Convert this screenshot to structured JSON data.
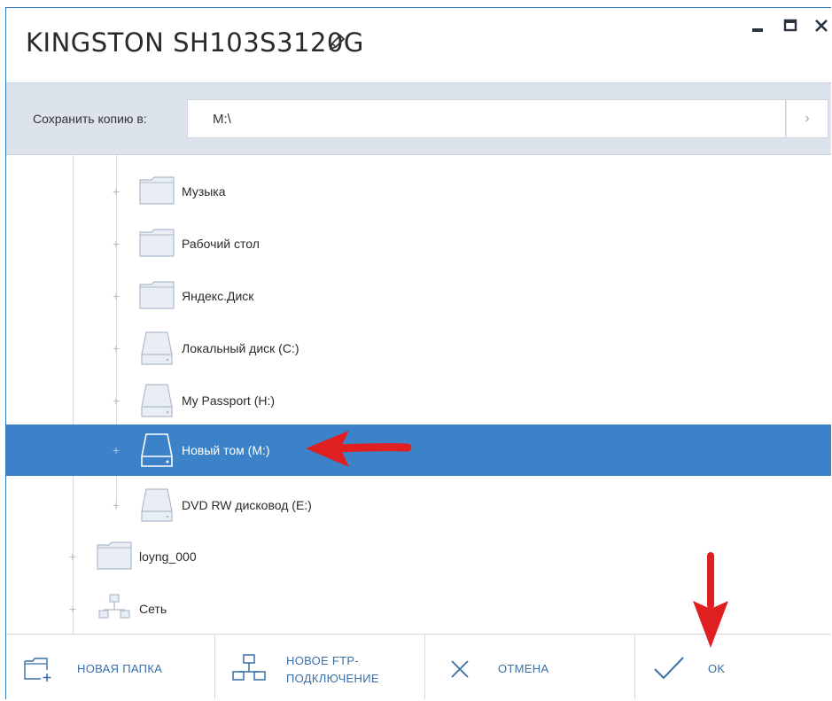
{
  "window": {
    "title": "KINGSTON SH103S3120G"
  },
  "pathbar": {
    "label": "Сохранить копию в:",
    "value": "M:\\",
    "go_glyph": "›"
  },
  "tree": {
    "items": [
      {
        "label": "Музыка",
        "icon": "folder-icon",
        "selected": false
      },
      {
        "label": "Рабочий стол",
        "icon": "folder-icon",
        "selected": false
      },
      {
        "label": "Яндекс.Диск",
        "icon": "folder-icon",
        "selected": false
      },
      {
        "label": "Локальный диск (C:)",
        "icon": "drive-icon",
        "selected": false
      },
      {
        "label": "My Passport (H:)",
        "icon": "drive-icon",
        "selected": false
      },
      {
        "label": "Новый том (M:)",
        "icon": "drive-icon",
        "selected": true
      },
      {
        "label": "DVD RW дисковод (E:)",
        "icon": "drive-icon",
        "selected": false
      },
      {
        "label": "loyng_000",
        "icon": "folder-icon",
        "selected": false
      },
      {
        "label": "Сеть",
        "icon": "network-icon",
        "selected": false
      }
    ]
  },
  "bottombar": {
    "new_folder": "НОВАЯ ПАПКА",
    "new_ftp_line1": "НОВОЕ FTP-",
    "new_ftp_line2": "ПОДКЛЮЧЕНИЕ",
    "cancel": "ОТМЕНА",
    "ok": "OK"
  },
  "colors": {
    "accent": "#3b82c8",
    "annotation_arrow": "#e02020"
  }
}
